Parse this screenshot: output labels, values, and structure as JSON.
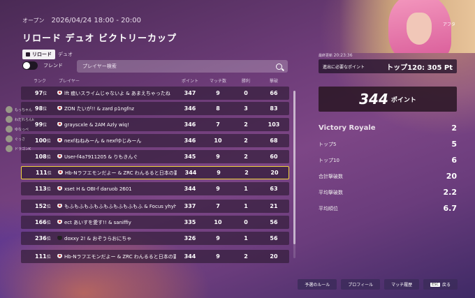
{
  "header": {
    "status": "オープン",
    "datetime": "2026/04/24 18:00 - 20:00",
    "title": "リロード デュオ ビクトリーカップ",
    "mode_chip": "リロード",
    "mode_label": "デュオ"
  },
  "controls": {
    "friends_label": "フレンド",
    "search_placeholder": "プレイヤー検索"
  },
  "table": {
    "headers": {
      "rank": "ランク",
      "player": "プレイヤー",
      "points": "ポイント",
      "matches": "マッチ数",
      "wins": "勝利",
      "kills": "撃破"
    },
    "rows": [
      {
        "rank": "97",
        "suffix": "位",
        "players": "lft 癒いスライムじゃないよ & あまえちゃったね",
        "points": "347",
        "matches": "9",
        "wins": "0",
        "kills": "66"
      },
      {
        "rank": "98",
        "suffix": "位",
        "players": "ZON たいが!! & zard p1ngfnz",
        "points": "346",
        "matches": "8",
        "wins": "3",
        "kills": "83"
      },
      {
        "rank": "99",
        "suffix": "位",
        "players": "grayscxle & 2AM Azly wiq!",
        "points": "346",
        "matches": "7",
        "wins": "2",
        "kills": "103"
      },
      {
        "rank": "100",
        "suffix": "位",
        "players": "nexfねねみーん & nexfゆじみーん",
        "points": "346",
        "matches": "10",
        "wins": "2",
        "kills": "68"
      },
      {
        "rank": "108",
        "suffix": "位",
        "players": "User-f4a7911205 & りもきんぐ",
        "points": "345",
        "matches": "9",
        "wins": "2",
        "kills": "60"
      },
      {
        "rank": "111",
        "suffix": "位",
        "players": "Hb-Nラフエモンだよー & ZRC わんるると日本の要茶",
        "points": "344",
        "matches": "9",
        "wins": "2",
        "kills": "20",
        "highlight": true
      },
      {
        "rank": "113",
        "suffix": "位",
        "players": "xset H & OBI-f daruob 2601",
        "points": "344",
        "matches": "9",
        "wins": "1",
        "kills": "63"
      },
      {
        "rank": "152",
        "suffix": "位",
        "players": "もふもふもふもふもふもふもふもふ & Focus yhyh23",
        "points": "337",
        "matches": "7",
        "wins": "1",
        "kills": "21"
      },
      {
        "rank": "166",
        "suffix": "位",
        "players": "ect あいすを愛す!! & saniffiy",
        "points": "335",
        "matches": "10",
        "wins": "0",
        "kills": "56"
      },
      {
        "rank": "236",
        "suffix": "位",
        "players": "doxxy 2! & おぞうらおにちゃ",
        "points": "326",
        "matches": "9",
        "wins": "1",
        "kills": "56"
      },
      {
        "rank": "111",
        "suffix": "位",
        "players": "Hb-Nラフエモンだよー & ZRC わんるると日本の要茶",
        "points": "344",
        "matches": "9",
        "wins": "2",
        "kills": "20"
      }
    ]
  },
  "side_friends": [
    "もっちゃん",
    "わだれらんk",
    "ゆなっぺ",
    "ぐっさ",
    "ドラゴンK"
  ],
  "hero": {
    "tag": "アフタ"
  },
  "summary": {
    "updated_label": "最終更新",
    "updated_time": "20:23:36",
    "required_label": "進出に必要なポイント",
    "required_value": "トップ120: 305 Pt",
    "points": "344",
    "points_unit": "ポイント",
    "stats": [
      {
        "label": "Victory Royale",
        "value": "2",
        "big": true
      },
      {
        "label": "トップ5",
        "value": "5"
      },
      {
        "label": "トップ10",
        "value": "6"
      },
      {
        "label": "合計撃破数",
        "value": "20"
      },
      {
        "label": "平均撃破数",
        "value": "2.2"
      },
      {
        "label": "平均順位",
        "value": "6.7"
      }
    ]
  },
  "footer": {
    "rules": "予選のルール",
    "profile": "プロフィール",
    "history": "マッチ履歴",
    "back_key": "ESC",
    "back": "戻る"
  }
}
